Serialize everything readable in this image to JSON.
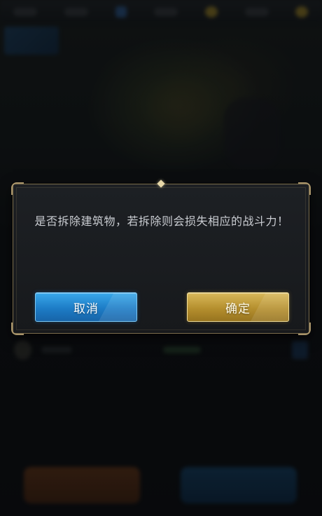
{
  "dialog": {
    "message": "是否拆除建筑物，若拆除则会损失相应的战斗力！",
    "cancel_label": "取消",
    "confirm_label": "确定"
  },
  "colors": {
    "cancel_button": "#1d7cc6",
    "confirm_button": "#b58f2e",
    "dialog_border": "#7c6e4e"
  }
}
